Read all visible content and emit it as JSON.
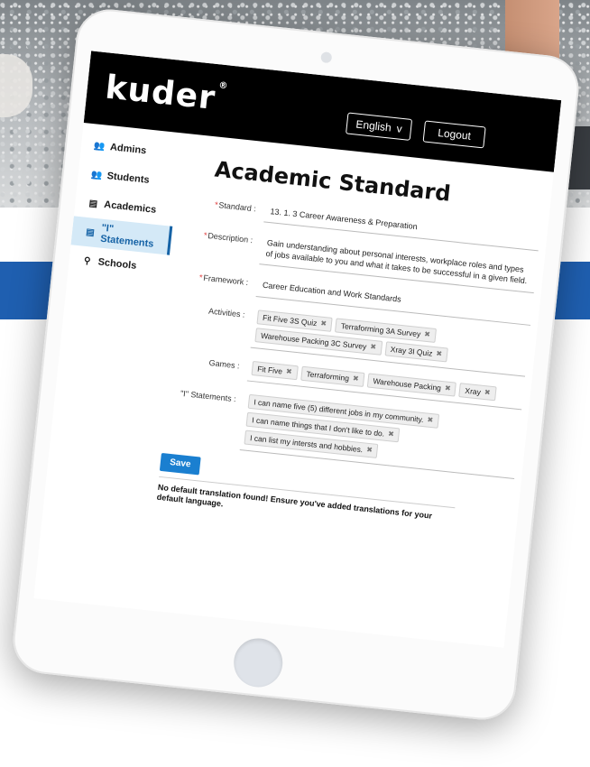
{
  "app": {
    "logo_text": "kuder",
    "logo_reg": "®"
  },
  "header": {
    "language_label": "English",
    "language_chevron": "v",
    "logout_label": "Logout"
  },
  "sidebar": {
    "items": [
      {
        "label": "Admins",
        "icon": "people-icon",
        "glyph": "👥"
      },
      {
        "label": "Students",
        "icon": "people-icon",
        "glyph": "👥"
      },
      {
        "label": "Academics",
        "icon": "list-icon",
        "glyph": "▤"
      },
      {
        "label": "\"I\" Statements",
        "icon": "list-icon",
        "glyph": "▤",
        "active": true
      },
      {
        "label": "Schools",
        "icon": "pin-icon",
        "glyph": "⚲"
      }
    ]
  },
  "page": {
    "title": "Academic Standard",
    "standard": {
      "label": "Standard :",
      "value": "13. 1. 3 Career Awareness & Preparation"
    },
    "description": {
      "label": "Description :",
      "value": "Gain understanding about personal interests, workplace roles and types of jobs available to you and what it takes to be successful in a given field."
    },
    "framework": {
      "label": "Framework :",
      "value": "Career Education and Work Standards"
    },
    "activities": {
      "label": "Activities :",
      "tags": [
        "Fit Five 3S Quiz",
        "Terraforming 3A Survey",
        "Warehouse Packing 3C Survey",
        "Xray 3I Quiz"
      ]
    },
    "games": {
      "label": "Games :",
      "tags": [
        "Fit Five",
        "Terraforming",
        "Warehouse Packing",
        "Xray"
      ]
    },
    "statements": {
      "label": "\"I\" Statements :",
      "tags": [
        "I can name five (5) different jobs in my community.",
        "I can name things that I don't like to do.",
        "I can list my intersts and hobbies."
      ]
    },
    "save_label": "Save",
    "warning": "No default translation found! Ensure you've added translations for your default language."
  },
  "tag_remove_glyph": "✖",
  "required_marker": "*",
  "colors": {
    "brand_blue": "#1f5fb0",
    "active_nav": "#1663a6",
    "save_button": "#1a7fd0"
  }
}
